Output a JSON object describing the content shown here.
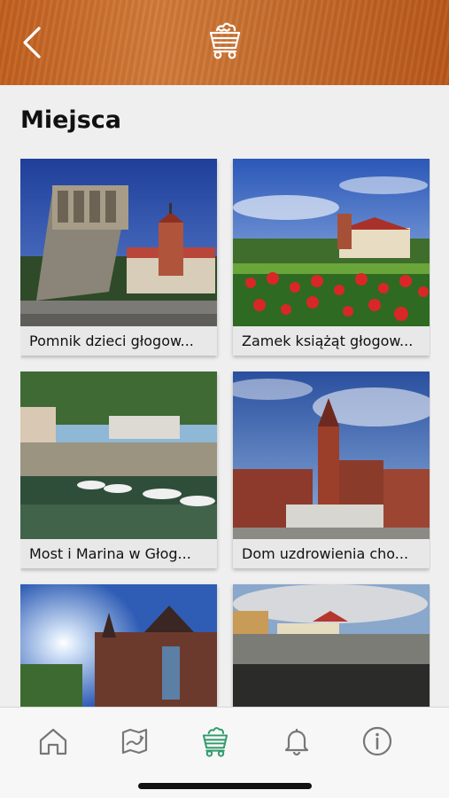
{
  "header": {
    "back_icon": "chevron-left-icon",
    "logo_icon": "mining-cart-icon",
    "brand_color": "#c4662a"
  },
  "page": {
    "title": "Miejsca"
  },
  "places": [
    {
      "caption": "Pomnik dzieci głogow...",
      "image": "monument-with-castle-photo"
    },
    {
      "caption": "Zamek książąt głogow...",
      "image": "castle-with-roses-photo"
    },
    {
      "caption": "Most i Marina w Głog...",
      "image": "marina-with-boats-photo"
    },
    {
      "caption": "Dom uzdrowienia cho...",
      "image": "church-tower-photo"
    },
    {
      "caption": "",
      "image": "gothic-church-sun-photo"
    },
    {
      "caption": "",
      "image": "town-buildings-photo"
    }
  ],
  "tabbar": {
    "active_color": "#2e9a6a",
    "items": [
      {
        "name": "home",
        "icon": "home-icon",
        "active": false
      },
      {
        "name": "map",
        "icon": "map-icon",
        "active": false
      },
      {
        "name": "places",
        "icon": "mining-cart-icon",
        "active": true
      },
      {
        "name": "notifications",
        "icon": "bell-icon",
        "active": false
      },
      {
        "name": "info",
        "icon": "info-icon",
        "active": false
      }
    ]
  }
}
